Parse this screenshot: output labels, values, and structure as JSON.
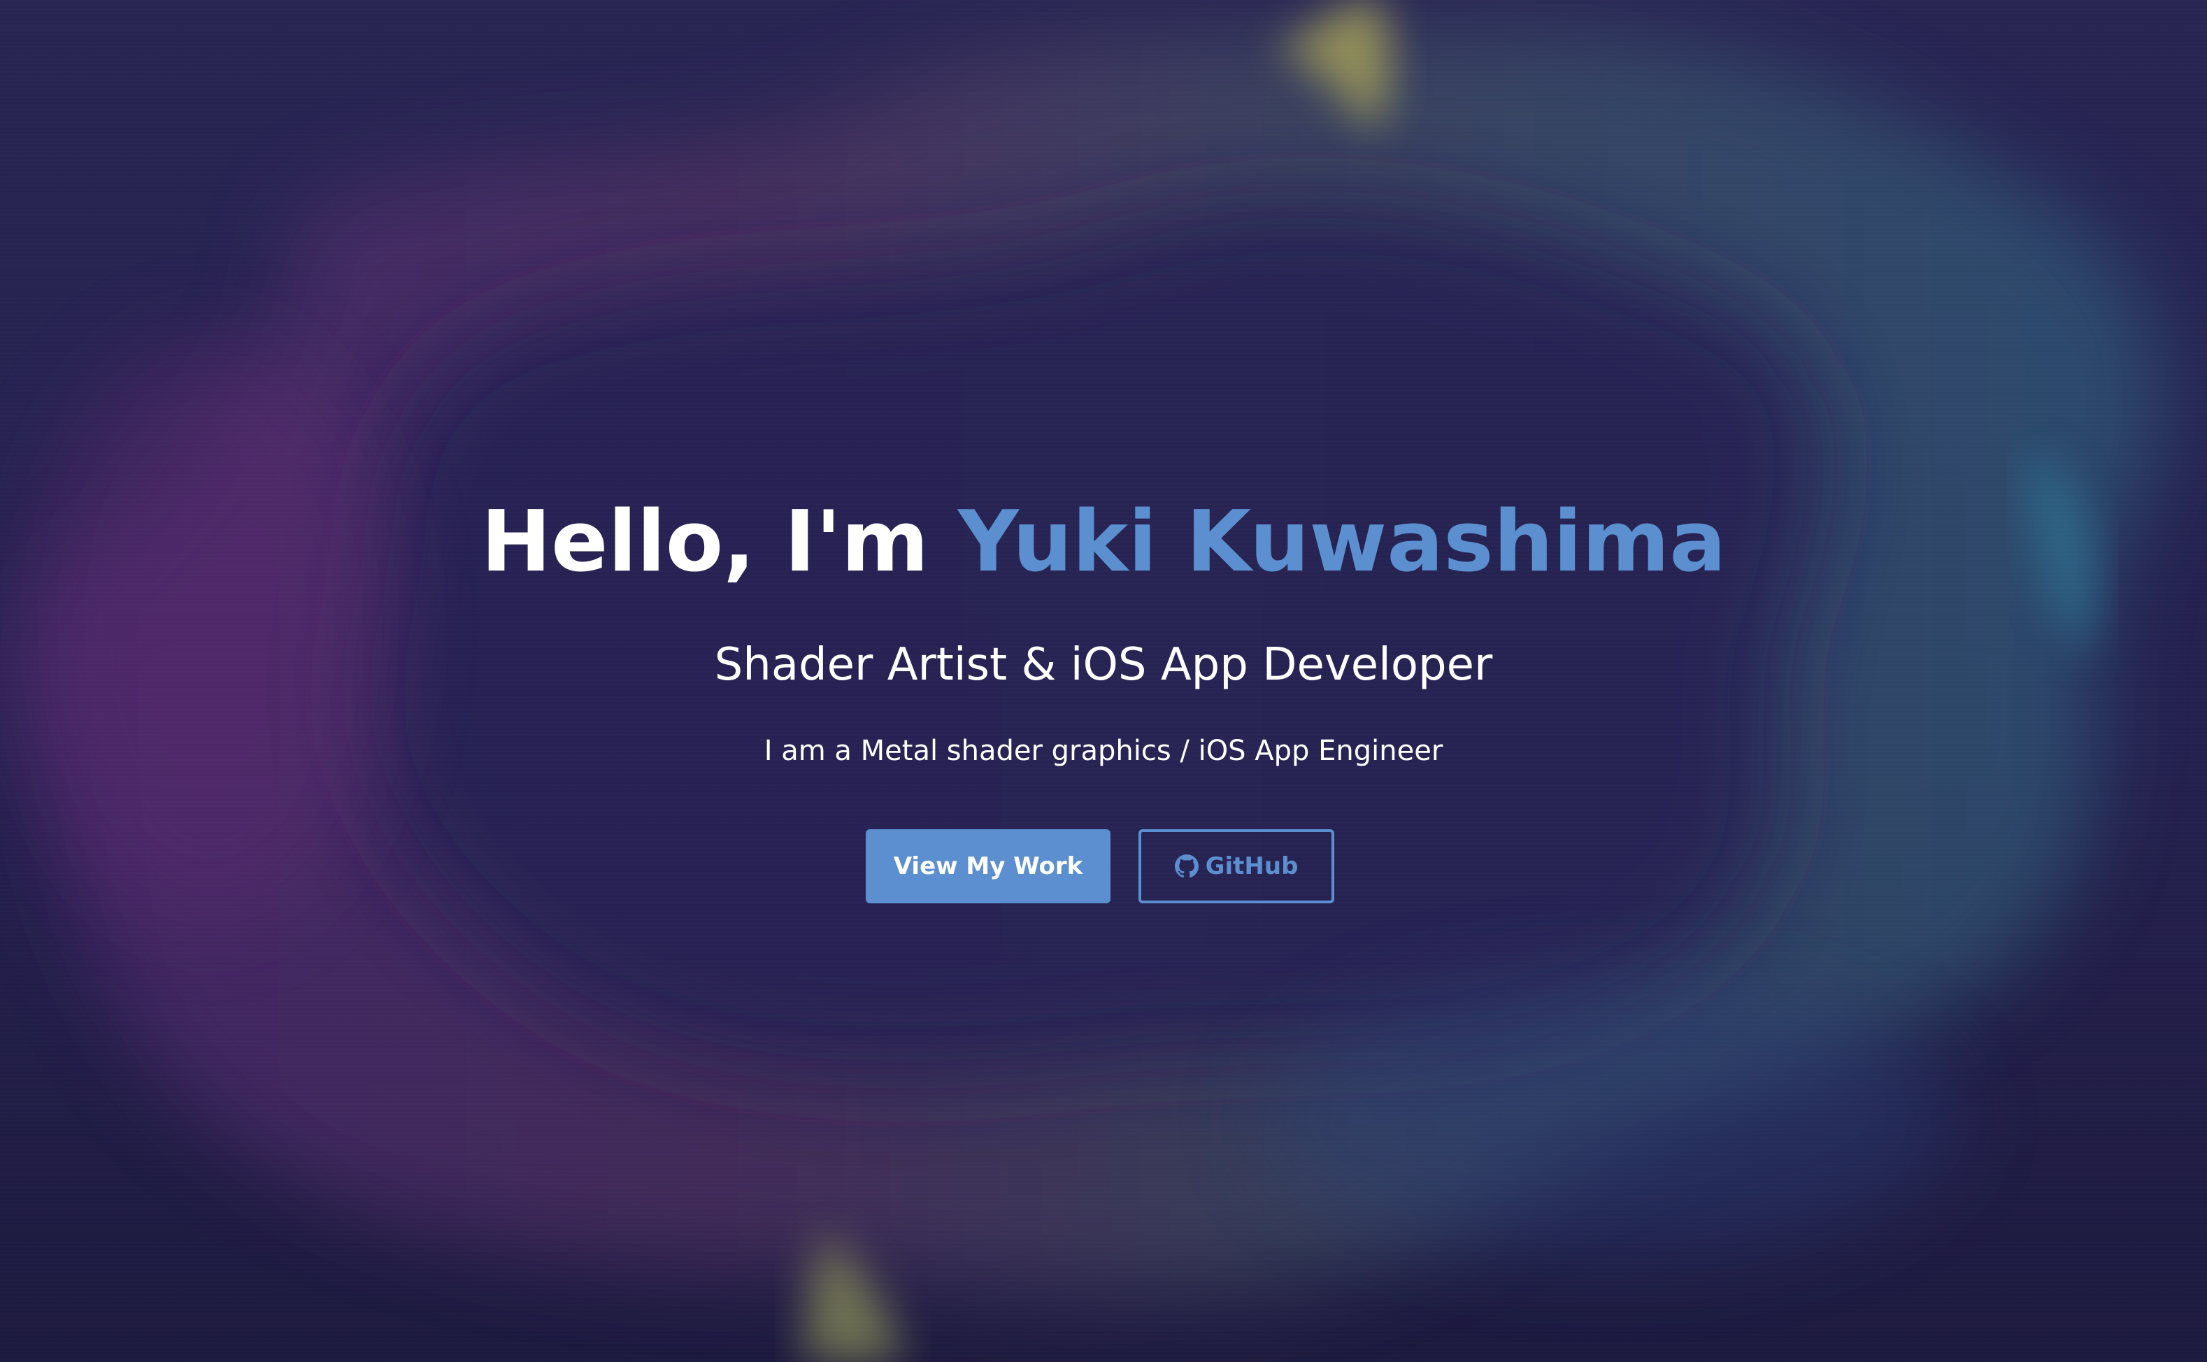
{
  "hero": {
    "greeting": "Hello, I'm ",
    "name": "Yuki Kuwashima",
    "subtitle": "Shader Artist & iOS App Developer",
    "tagline": "I am a Metal shader graphics / iOS App Engineer"
  },
  "actions": {
    "primary_label": "View My Work",
    "secondary_label": "GitHub",
    "secondary_icon": "github-icon"
  },
  "colors": {
    "accent": "#5b8fcf",
    "background": "#25214f",
    "text": "#ffffff"
  }
}
